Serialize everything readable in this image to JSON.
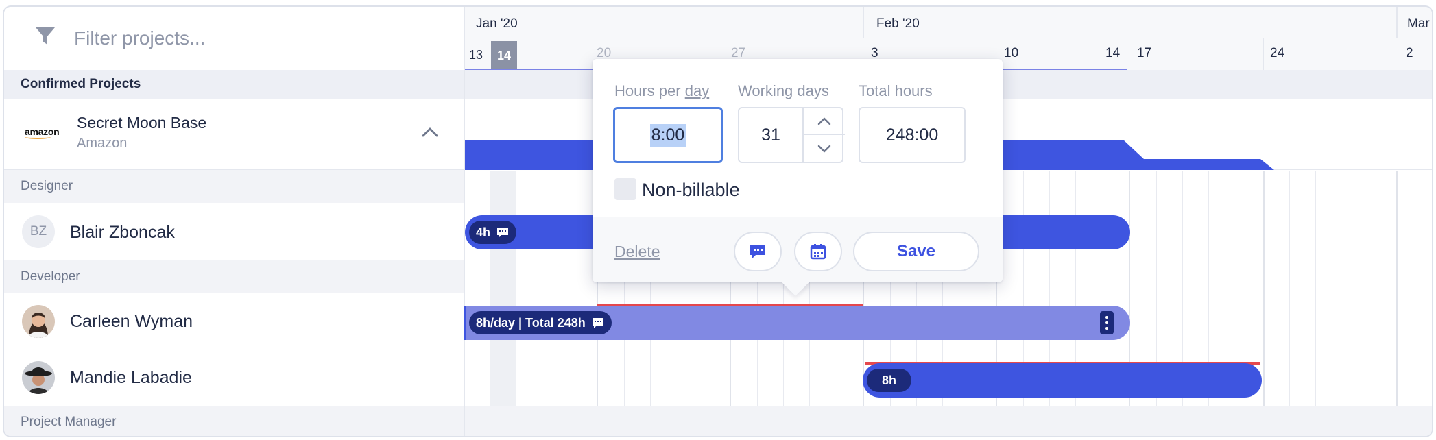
{
  "filter": {
    "placeholder": "Filter projects..."
  },
  "sections": {
    "confirmed": "Confirmed Projects"
  },
  "project": {
    "name": "Secret Moon Base",
    "client": "Amazon",
    "logo_text": "amazon"
  },
  "roles": {
    "designer": "Designer",
    "developer": "Developer",
    "project_manager": "Project Manager"
  },
  "people": [
    {
      "name": "Blair Zboncak",
      "initials": "BZ"
    },
    {
      "name": "Carleen Wyman",
      "initials": ""
    },
    {
      "name": "Mandie Labadie",
      "initials": ""
    }
  ],
  "timeline": {
    "months": [
      "Jan '20",
      "Feb '20",
      "Mar"
    ],
    "weeks": [
      "13",
      "14",
      "20",
      "27",
      "3",
      "10",
      "14",
      "17",
      "24",
      "2"
    ],
    "today": "14"
  },
  "allocations": {
    "blair": "4h",
    "carleen": "8h/day | Total 248h",
    "mandie": "8h"
  },
  "popover": {
    "hours_per_label_a": "Hours per ",
    "hours_per_label_b": "day",
    "working_days_label": "Working days",
    "total_hours_label": "Total hours",
    "hours_per_day": "8:00",
    "working_days": "31",
    "total_hours": "248:00",
    "non_billable": "Non-billable",
    "delete": "Delete",
    "save": "Save"
  },
  "colors": {
    "bar_blue": "#3e55e0",
    "bar_light": "#8189e3",
    "pill_dark": "#1c2a7a",
    "over_alloc": "#e5484d"
  }
}
